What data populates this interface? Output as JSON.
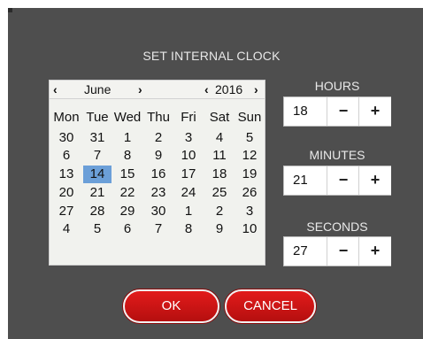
{
  "dialog": {
    "title": "SET INTERNAL CLOCK"
  },
  "calendar": {
    "prev_month": "‹",
    "month": "June",
    "next_month": "›",
    "prev_year": "‹",
    "year": "2016",
    "next_year": "›",
    "weekdays": [
      "Mon",
      "Tue",
      "Wed",
      "Thu",
      "Fri",
      "Sat",
      "Sun"
    ],
    "weeks": [
      [
        "30",
        "31",
        "1",
        "2",
        "3",
        "4",
        "5"
      ],
      [
        "6",
        "7",
        "8",
        "9",
        "10",
        "11",
        "12"
      ],
      [
        "13",
        "14",
        "15",
        "16",
        "17",
        "18",
        "19"
      ],
      [
        "20",
        "21",
        "22",
        "23",
        "24",
        "25",
        "26"
      ],
      [
        "27",
        "28",
        "29",
        "30",
        "1",
        "2",
        "3"
      ],
      [
        "4",
        "5",
        "6",
        "7",
        "8",
        "9",
        "10"
      ]
    ],
    "selected_day": "14",
    "selected_color": "#6b9fd8"
  },
  "time": {
    "hours": {
      "label": "HOURS",
      "value": "18",
      "minus": "−",
      "plus": "+"
    },
    "minutes": {
      "label": "MINUTES",
      "value": "21",
      "minus": "−",
      "plus": "+"
    },
    "seconds": {
      "label": "SECONDS",
      "value": "27",
      "minus": "−",
      "plus": "+"
    }
  },
  "buttons": {
    "ok": "OK",
    "cancel": "CANCEL",
    "color": "#d11515"
  },
  "colors": {
    "background": "#4e4e4e"
  }
}
